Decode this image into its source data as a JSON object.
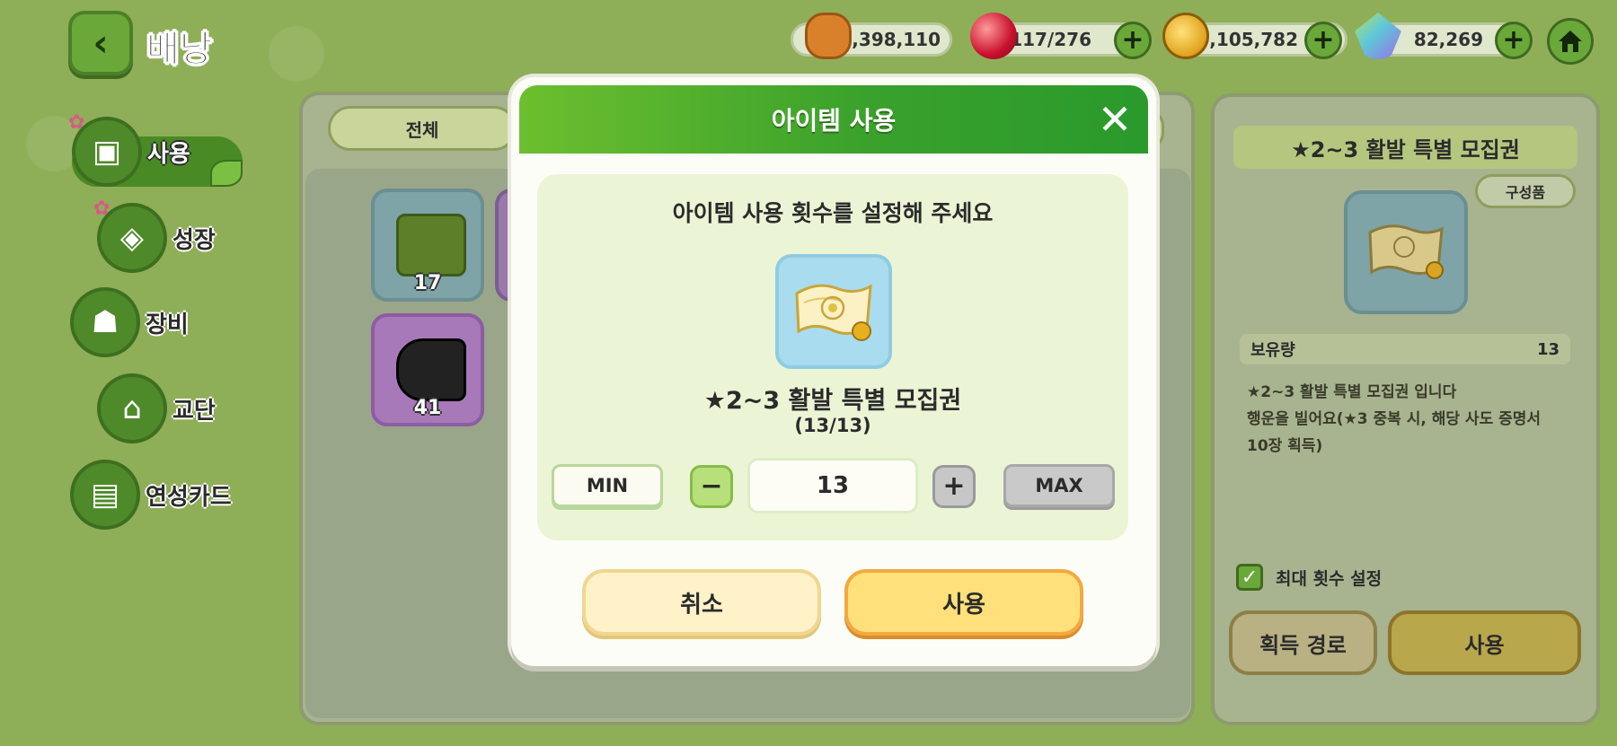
{
  "header": {
    "title": "배낭"
  },
  "currencies": [
    {
      "name": "cookie-currency",
      "value": "2,398,110",
      "icon": "cookie-icon"
    },
    {
      "name": "gem-currency",
      "value": "117/276",
      "icon": "red-gem-icon"
    },
    {
      "name": "coin-currency",
      "value": "6,105,782",
      "icon": "gold-coin-icon"
    },
    {
      "name": "crystal-currency",
      "value": "82,269",
      "icon": "crystal-icon"
    }
  ],
  "sidebar": {
    "items": [
      {
        "label": "사용",
        "icon": "chest-icon",
        "active": true
      },
      {
        "label": "성장",
        "icon": "potion-icon"
      },
      {
        "label": "장비",
        "icon": "equipment-icon"
      },
      {
        "label": "교단",
        "icon": "temple-icon"
      },
      {
        "label": "연성카드",
        "icon": "card-icon"
      }
    ]
  },
  "inventory": {
    "filter_label": "전체",
    "items": [
      {
        "count": "17",
        "icon": "green-ticket-icon"
      },
      {
        "count": "41",
        "icon": "film-roll-icon"
      }
    ]
  },
  "detail": {
    "title": "★2~3 활발 특별 모집권",
    "compose_label": "구성품",
    "qty_label": "보유량",
    "qty_value": "13",
    "description_line1": "★2~3 활발 특별 모집권 입니다",
    "description_line2": "행운을 빌어요(★3 중복 시, 해당 사도 증명서",
    "description_line3": "10장 획득)",
    "max_count_label": "최대 횟수 설정",
    "path_button": "획득 경로",
    "use_button": "사용"
  },
  "modal": {
    "title": "아이템 사용",
    "prompt": "아이템 사용 횟수를 설정해 주세요",
    "item_name": "★2~3 활발 특별 모집권",
    "item_count": "(13/13)",
    "min_label": "MIN",
    "max_label": "MAX",
    "quantity": "13",
    "cancel_label": "취소",
    "confirm_label": "사용"
  },
  "colors": {
    "header_green": "#3aa12c",
    "confirm_yellow": "#ffe07a",
    "background_green": "#8fae58"
  }
}
